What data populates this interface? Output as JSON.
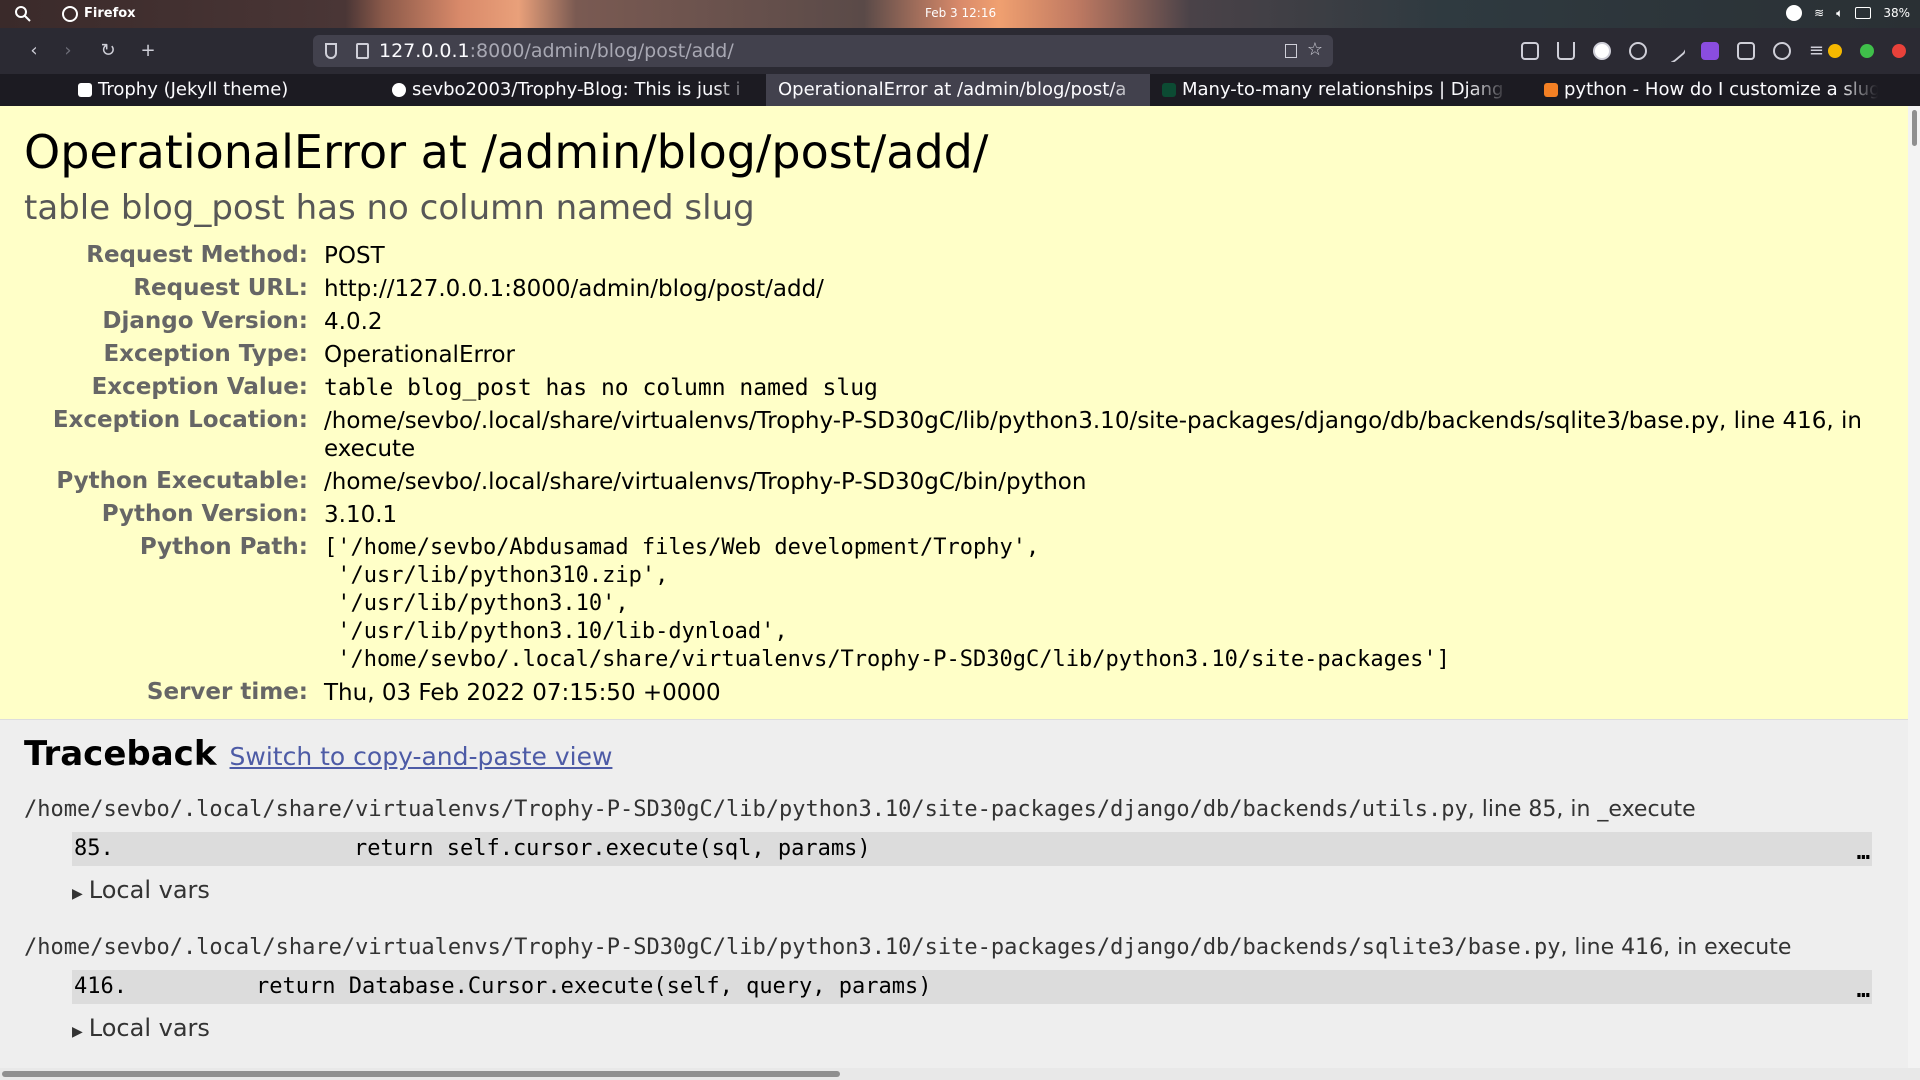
{
  "system": {
    "app_name": "Firefox",
    "clock": "Feb 3  12:16",
    "battery": "38%"
  },
  "browser": {
    "url_host": "127.0.0.1",
    "url_rest": ":8000/admin/blog/post/add/",
    "tabs": [
      {
        "label": "Trophy (Jekyll theme)"
      },
      {
        "label": "sevbo2003/Trophy-Blog: This is just i"
      },
      {
        "label": "OperationalError at /admin/blog/post/a"
      },
      {
        "label": "Many-to-many relationships | Djang"
      },
      {
        "label": "python - How do I customize a slug f"
      }
    ]
  },
  "error": {
    "title": "OperationalError at /admin/blog/post/add/",
    "subtitle": "table blog_post has no column named slug",
    "meta": [
      {
        "label": "Request Method:",
        "value": "POST"
      },
      {
        "label": "Request URL:",
        "value": "http://127.0.0.1:8000/admin/blog/post/add/"
      },
      {
        "label": "Django Version:",
        "value": "4.0.2"
      },
      {
        "label": "Exception Type:",
        "value": "OperationalError"
      },
      {
        "label": "Exception Value:",
        "value": "table blog_post has no column named slug"
      },
      {
        "label": "Exception Location:",
        "value": "/home/sevbo/.local/share/virtualenvs/Trophy-P-SD30gC/lib/python3.10/site-packages/django/db/backends/sqlite3/base.py, line 416, in execute"
      },
      {
        "label": "Python Executable:",
        "value": "/home/sevbo/.local/share/virtualenvs/Trophy-P-SD30gC/bin/python"
      },
      {
        "label": "Python Version:",
        "value": "3.10.1"
      },
      {
        "label": "Python Path:",
        "value": "['/home/sevbo/Abdusamad files/Web development/Trophy',\n '/usr/lib/python310.zip',\n '/usr/lib/python3.10',\n '/usr/lib/python3.10/lib-dynload',\n '/home/sevbo/.local/share/virtualenvs/Trophy-P-SD30gC/lib/python3.10/site-packages']"
      },
      {
        "label": "Server time:",
        "value": "Thu, 03 Feb 2022 07:15:50 +0000"
      }
    ]
  },
  "traceback": {
    "title": "Traceback",
    "switch_link": "Switch to copy-and-paste view",
    "frames": [
      {
        "file": "/home/sevbo/.local/share/virtualenvs/Trophy-P-SD30gC/lib/python3.10/site-packages/django/db/backends/utils.py",
        "location": ", line 85, in _execute",
        "line_no": "85.",
        "code": "return self.cursor.execute(sql, params)",
        "more": "…",
        "local_vars": "Local vars"
      },
      {
        "file": "/home/sevbo/.local/share/virtualenvs/Trophy-P-SD30gC/lib/python3.10/site-packages/django/db/backends/sqlite3/base.py",
        "location": ", line 416, in execute",
        "line_no": "416.",
        "code": "return Database.Cursor.execute(self, query, params)",
        "more": "…",
        "local_vars": "Local vars"
      }
    ]
  }
}
